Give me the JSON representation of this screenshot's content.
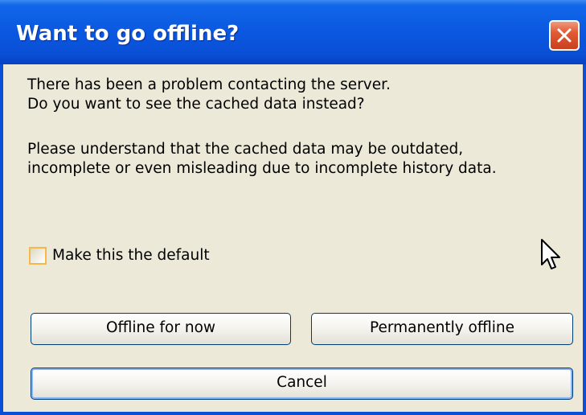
{
  "dialog": {
    "title": "Want to go offline?",
    "close_icon": "close-icon",
    "message_line_1": "There has been a problem contacting the server.",
    "message_line_2": "Do you want to see the cached data instead?",
    "warning_line_1": "Please understand that the cached data may be outdated,",
    "warning_line_2": "incomplete or even misleading due to incomplete history data.",
    "checkbox_label": "Make this the default",
    "checkbox_checked": false,
    "buttons": {
      "offline_now": "Offline for now",
      "permanently_offline": "Permanently offline",
      "cancel": "Cancel"
    }
  },
  "colors": {
    "titlebar": "#0a4fd6",
    "client_background": "#ece9d8",
    "close_button": "#e15a34",
    "checkbox_border": "#f5b84b"
  }
}
